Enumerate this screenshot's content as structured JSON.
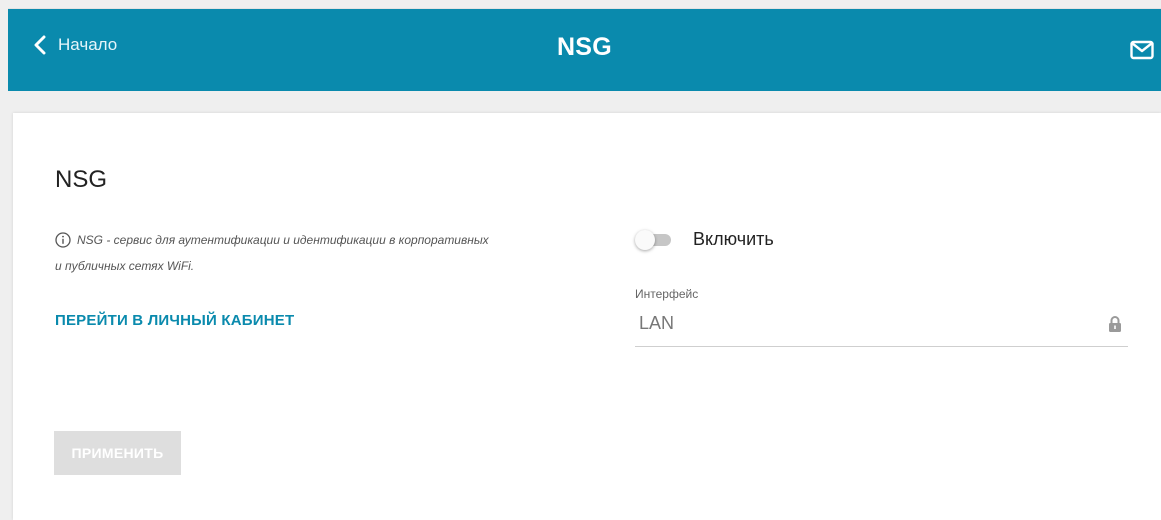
{
  "header": {
    "back_label": "Начало",
    "title": "NSG",
    "mail_icon": "mail-icon",
    "back_icon": "chevron-left-icon",
    "background_color": "#0a8aad"
  },
  "main": {
    "title": "NSG",
    "info_text": "NSG - сервис для аутентификации и идентификации в корпоративных и публичных сетях WiFi.",
    "info_icon": "info-icon",
    "cabinet_link_label": "ПЕРЕЙТИ В ЛИЧНЫЙ КАБИНЕТ",
    "enable_toggle": {
      "label": "Включить",
      "state": "off"
    },
    "interface_field": {
      "label": "Интерфейс",
      "value": "LAN",
      "locked": true,
      "lock_icon": "lock-icon"
    },
    "apply_button_label": "ПРИМЕНИТЬ",
    "apply_button_enabled": false,
    "accent_color": "#0a8aad"
  }
}
